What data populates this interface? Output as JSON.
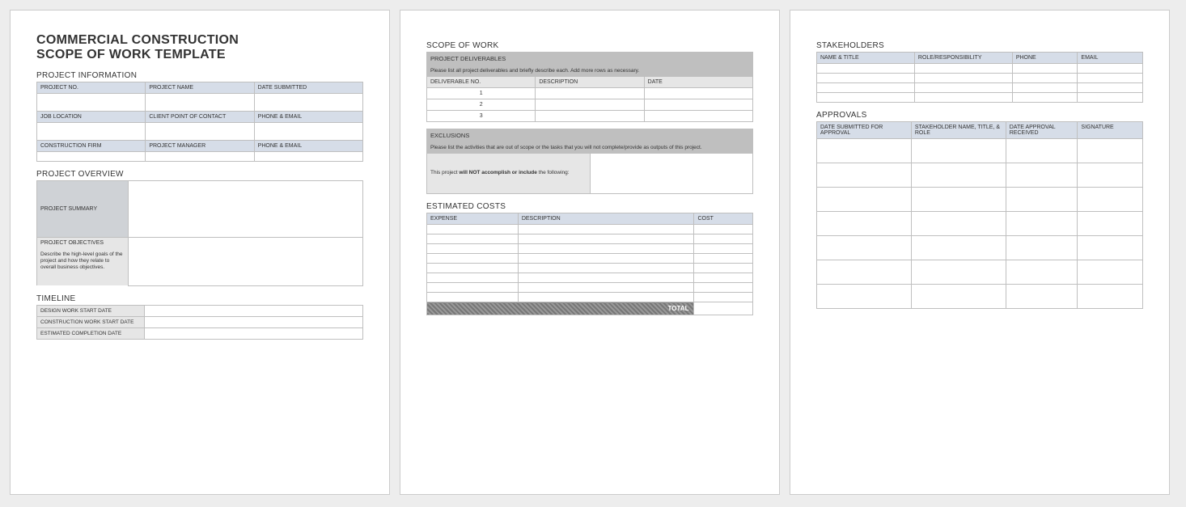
{
  "title_line1": "COMMERCIAL CONSTRUCTION",
  "title_line2": "SCOPE OF WORK TEMPLATE",
  "sections": {
    "project_info": "PROJECT INFORMATION",
    "project_overview": "PROJECT OVERVIEW",
    "timeline": "TIMELINE",
    "scope_of_work": "SCOPE OF WORK",
    "estimated_costs": "ESTIMATED COSTS",
    "stakeholders": "STAKEHOLDERS",
    "approvals": "APPROVALS"
  },
  "project_info": {
    "row1": {
      "c1": "PROJECT NO.",
      "c2": "PROJECT NAME",
      "c3": "DATE SUBMITTED"
    },
    "row2": {
      "c1": "JOB LOCATION",
      "c2": "CLIENT POINT OF CONTACT",
      "c3": "PHONE & EMAIL"
    },
    "row3": {
      "c1": "CONSTRUCTION FIRM",
      "c2": "PROJECT MANAGER",
      "c3": "PHONE & EMAIL"
    }
  },
  "overview": {
    "summary_label": "PROJECT SUMMARY",
    "objectives_label": "PROJECT OBJECTIVES",
    "objectives_desc": "Describe the high-level goals of the project and how they relate to overall business objectives."
  },
  "timeline": {
    "r1": "DESIGN WORK START DATE",
    "r2": "CONSTRUCTION WORK START DATE",
    "r3": "ESTIMATED COMPLETION DATE"
  },
  "deliverables": {
    "header": "PROJECT DELIVERABLES",
    "instruction": "Please list all project deliverables and briefly describe each. Add more rows as necessary.",
    "cols": {
      "c1": "DELIVERABLE NO.",
      "c2": "DESCRIPTION",
      "c3": "DATE"
    },
    "rows": [
      "1",
      "2",
      "3"
    ]
  },
  "exclusions": {
    "header": "EXCLUSIONS",
    "instruction": "Please list the activities that are out of scope or the tasks that you will not complete/provide as outputs of this project.",
    "left_text_1": "This project ",
    "left_bold": "will NOT accomplish or include",
    "left_text_2": " the following:"
  },
  "costs": {
    "cols": {
      "c1": "EXPENSE",
      "c2": "DESCRIPTION",
      "c3": "COST"
    },
    "total_label": "TOTAL"
  },
  "stakeholders": {
    "cols": {
      "c1": "NAME & TITLE",
      "c2": "ROLE/RESPONSIBILITY",
      "c3": "PHONE",
      "c4": "EMAIL"
    }
  },
  "approvals": {
    "cols": {
      "c1": "DATE SUBMITTED FOR APPROVAL",
      "c2": "STAKEHOLDER NAME, TITLE, & ROLE",
      "c3": "DATE APPROVAL RECEIVED",
      "c4": "SIGNATURE"
    }
  }
}
